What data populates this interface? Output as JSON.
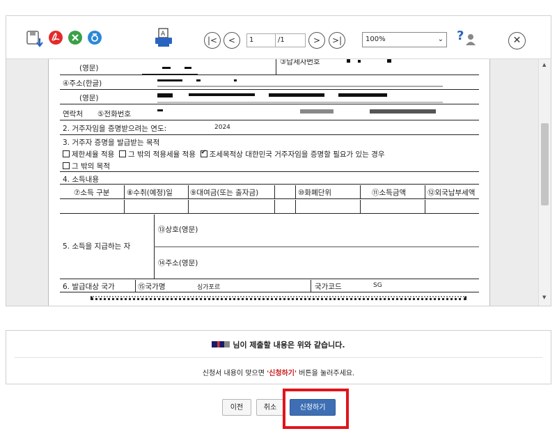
{
  "viewer": {
    "toolbar": {
      "page_input": "1",
      "page_total": "/1",
      "zoom": "100%",
      "help": "?"
    },
    "form": {
      "row_english_name": "(영문)",
      "taxpayer_no_label": "③납세자번호",
      "address_kr_label": "④주소(한글)",
      "address_en_label": "(영문)",
      "contact_label": "연락처",
      "phone_label": "⑤전화번호",
      "year_label": "2. 거주자임을 증명받으려는 연도:",
      "year_value": "2024",
      "purpose_label": "3. 거주자 증명을 발급받는 목적",
      "purpose_opt1": "제한세율 적용",
      "purpose_opt2": "그 밖의 적용세율 적용",
      "purpose_opt3": "조세목적상 대한민국 거주자임을 증명할 필요가 있는 경우",
      "purpose_opt4": "그 밖의 목적",
      "income_label": "4. 소득내용",
      "income_headers": [
        "⑦소득 구분",
        "⑧수취(예정)일",
        "⑨대여금(또는 출자금)",
        "⑩화폐단위",
        "⑪소득금액",
        "⑫외국납부세액"
      ],
      "payer_label": "5. 소득을 지급하는 자",
      "payer_name_label": "⑬상호(영문)",
      "payer_address_label": "⑭주소(영문)",
      "country_label": "6. 발급대상 국가",
      "country_name_label": "⑮국가명",
      "country_name_value": "싱가포르",
      "country_code_label": "국가코드",
      "country_code_value": "SG"
    }
  },
  "info": {
    "line1": "님이 제출할 내용은 위와 같습니다.",
    "line2_pre": "신청서 내용이 맞으면 ",
    "line2_accent": "'신청하기'",
    "line2_post": " 버튼을 눌러주세요."
  },
  "buttons": {
    "prev": "이전",
    "cancel": "취소",
    "submit": "신청하기"
  },
  "colors": {
    "primary_button": "#3e6fb4",
    "highlight_box": "#e1141b",
    "accent_text": "#c81c1c"
  },
  "icons": [
    "save-icon",
    "pdf-icon",
    "excel-icon",
    "hwp-icon",
    "print-icon",
    "first-page-icon",
    "prev-page-icon",
    "next-page-icon",
    "last-page-icon",
    "help-icon",
    "close-icon"
  ]
}
